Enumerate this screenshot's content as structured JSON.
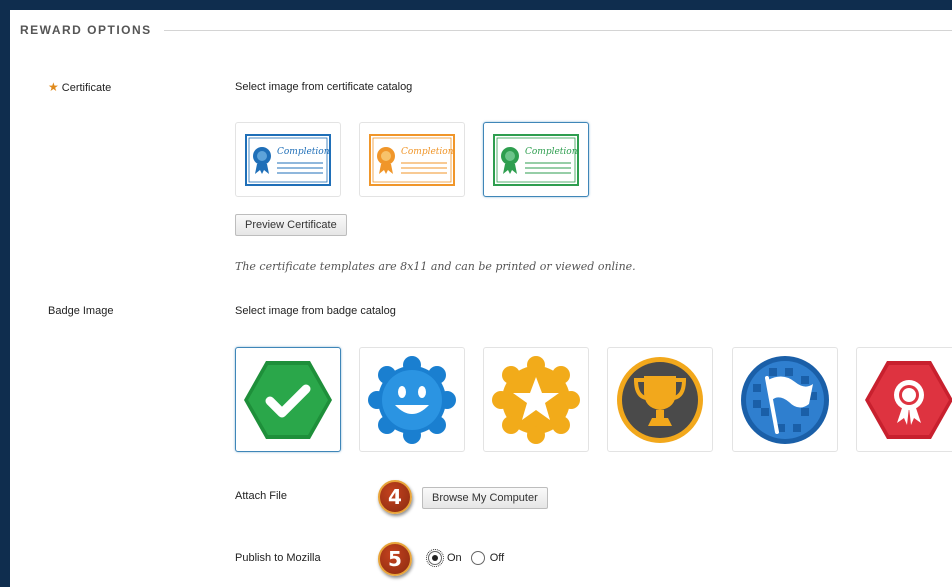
{
  "section": {
    "title": "REWARD OPTIONS"
  },
  "certificate": {
    "label": "Certificate",
    "instruction": "Select image from certificate catalog",
    "thumbs": [
      {
        "name": "blue",
        "color": "#1f6fb8",
        "text": "Completion"
      },
      {
        "name": "orange",
        "color": "#f0962a",
        "text": "Completion"
      },
      {
        "name": "green",
        "color": "#2e9e4f",
        "text": "Completion"
      }
    ],
    "preview_button": "Preview Certificate",
    "note": "The certificate templates are 8x11 and can be printed or viewed online."
  },
  "badge": {
    "label": "Badge Image",
    "instruction": "Select image from badge catalog"
  },
  "attach": {
    "label": "Attach File",
    "step": "4",
    "browse_button": "Browse My Computer"
  },
  "publish": {
    "label": "Publish to Mozilla",
    "step": "5",
    "on_label": "On",
    "off_label": "Off",
    "selected": "On"
  },
  "colors": {
    "frame": "#0f2d4e",
    "accent_selected": "#3f86b8",
    "required_star": "#e08a1c"
  }
}
